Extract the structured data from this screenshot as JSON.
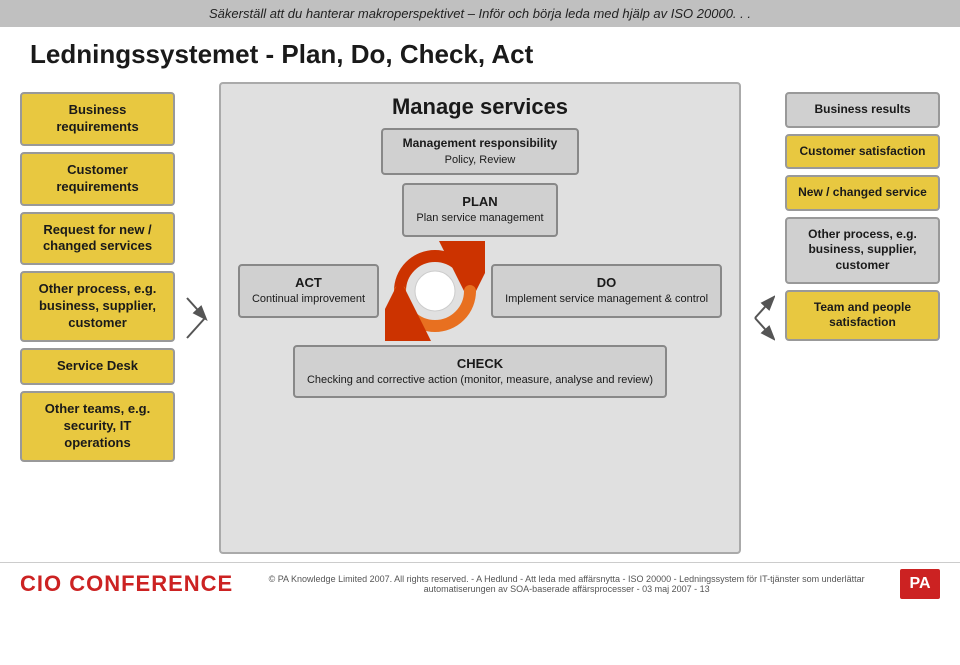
{
  "banner": {
    "text": "Säkerställ att du hanterar makroperspektivet – Inför och börja leda med hjälp av ISO 20000. . ."
  },
  "title": "Ledningssystemet - Plan, Do, Check, Act",
  "left_col": {
    "items": [
      {
        "label": "Business requirements"
      },
      {
        "label": "Customer requirements"
      },
      {
        "label": "Request for new / changed services"
      },
      {
        "label": "Other process, e.g. business, supplier, customer"
      },
      {
        "label": "Service Desk"
      },
      {
        "label": "Other teams, e.g. security, IT operations"
      }
    ]
  },
  "center": {
    "manage_title": "Manage services",
    "mgmt_resp": "Management responsibility\nPolicy, Review",
    "plan_box": "PLAN\nPlan service\nmanagement",
    "act_box": "ACT\nContinual\nimprovement",
    "do_box": "DO\nImplement\nservice\nmanagement\n& control",
    "check_box": "CHECK\nChecking and corrective\naction (monitor, measure,\nanalyse and review)"
  },
  "right_col": {
    "items": [
      {
        "label": "Business results",
        "type": "gray"
      },
      {
        "label": "Customer satisfaction",
        "type": "yellow"
      },
      {
        "label": "New / changed service",
        "type": "yellow"
      },
      {
        "label": "Other process, e.g. business, supplier, customer",
        "type": "gray"
      },
      {
        "label": "Team and people satisfaction",
        "type": "yellow"
      }
    ]
  },
  "footer": {
    "cio_text": "CIO CONFERENCE",
    "pa_logo": "PA",
    "copyright": "© PA Knowledge Limited 2007. All rights reserved. - A Hedlund - Att leda med affärsnytta - ISO 20000 - Ledningssystem för IT-tjänster som underlättar automatiserungen av SOA-baserade affärsprocesser - 03 maj 2007 - 13"
  }
}
